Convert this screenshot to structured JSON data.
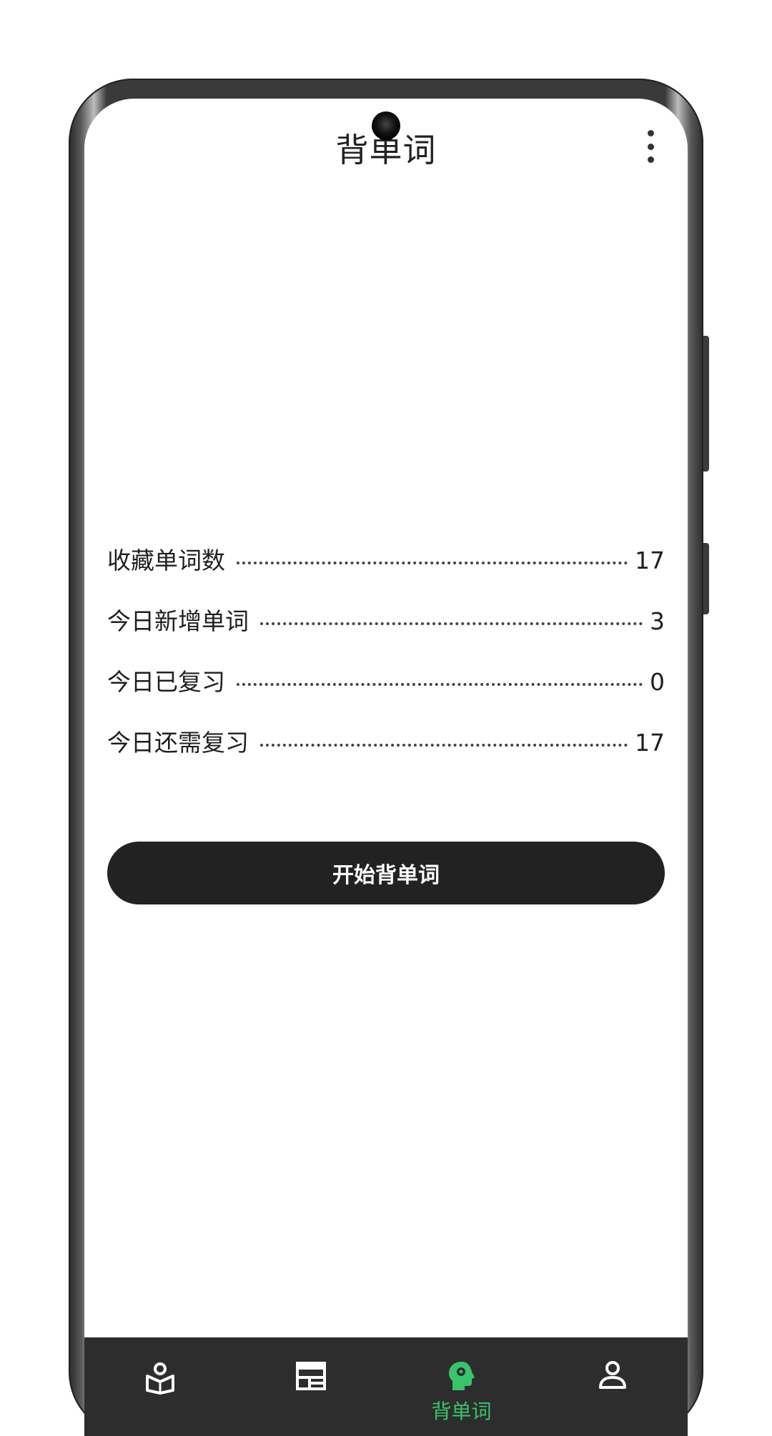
{
  "header": {
    "title": "背单词",
    "more_icon": "more-vert-icon"
  },
  "stats": [
    {
      "label": "收藏单词数",
      "value": "17"
    },
    {
      "label": "今日新增单词",
      "value": "3"
    },
    {
      "label": "今日已复习",
      "value": "0"
    },
    {
      "label": "今日还需复习",
      "value": "17"
    }
  ],
  "start_button": {
    "label": "开始背单词"
  },
  "tabbar": {
    "tabs": [
      {
        "icon": "book-reader-icon",
        "label": ""
      },
      {
        "icon": "calendar-table-icon",
        "label": ""
      },
      {
        "icon": "head-gear-icon",
        "label": "背单词",
        "active": true
      },
      {
        "icon": "user-icon",
        "label": ""
      }
    ],
    "active_color": "#39c36b",
    "inactive_color": "#ffffff",
    "background": "#2d2d2d"
  },
  "colors": {
    "button_bg": "#222222",
    "text": "#1f1f1f"
  }
}
